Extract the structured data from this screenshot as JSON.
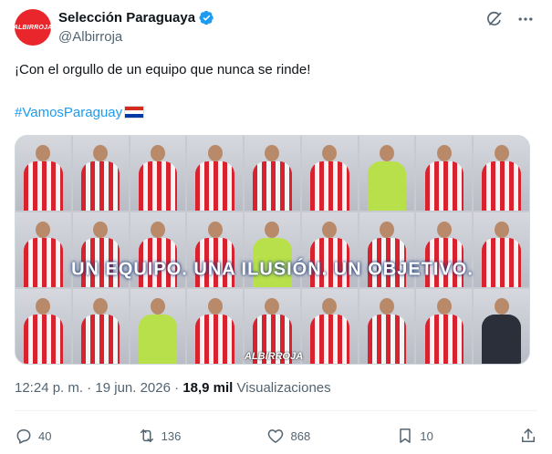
{
  "account": {
    "display_name": "Selección Paraguaya",
    "handle": "@Albirroja",
    "avatar_text": "ALBIRROJA"
  },
  "post": {
    "text": "¡Con el orgullo de un equipo que nunca se rinde!",
    "hashtag": "#VamosParaguay",
    "image_banner": "UN EQUIPO. UNA ILUSIÓN. UN OBJETIVO.",
    "image_brand": "ALBIRROJA"
  },
  "meta": {
    "time": "12:24 p. m.",
    "separator": "·",
    "date": "19 jun. 2026",
    "views_count": "18,9 mil",
    "views_label": "Visualizaciones"
  },
  "actions": {
    "replies": "40",
    "reposts": "136",
    "likes": "868",
    "bookmarks": "10"
  },
  "icons": [
    "verified-badge-icon",
    "grok-icon",
    "more-icon",
    "reply-icon",
    "repost-icon",
    "like-icon",
    "bookmark-icon",
    "share-icon"
  ],
  "colors": {
    "accent": "#1d9bf0",
    "text_primary": "#0f1419",
    "text_secondary": "#536471",
    "avatar_red": "#e8262c",
    "flag_red": "#d52b1e",
    "flag_blue": "#0038a8"
  }
}
